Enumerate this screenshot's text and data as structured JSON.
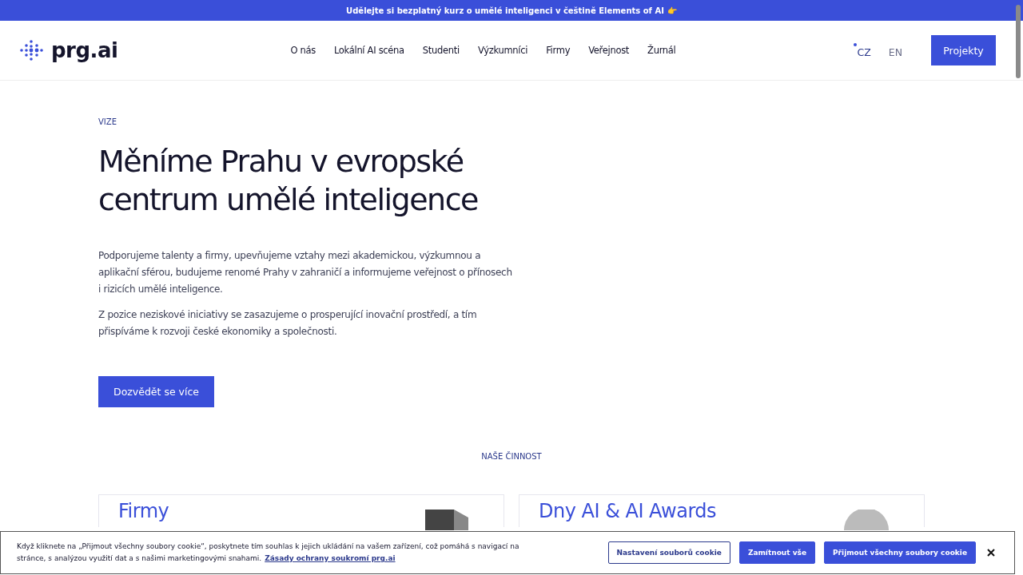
{
  "announcement": {
    "text": "Udělejte si bezplatný kurz o umělé inteligenci v češtině Elements of AI",
    "emoji": "👉"
  },
  "header": {
    "logo": "prg.ai",
    "nav": [
      "O nás",
      "Lokální AI scéna",
      "Studenti",
      "Výzkumníci",
      "Firmy",
      "Veřejnost",
      "Žurnál"
    ],
    "languages": [
      {
        "label": "CZ",
        "selected": true
      },
      {
        "label": "EN",
        "selected": false
      }
    ],
    "cta": "Projekty"
  },
  "hero": {
    "eyebrow": "VIZE",
    "title": "Měníme Prahu v evropské centrum umělé inteligence",
    "paragraphs": [
      "Podporujeme talenty a firmy, upevňujeme vztahy mezi akademickou, výzkumnou a aplikační sférou, budujeme renomé Prahy v zahraničí a informujeme veřejnost o přínosech i rizicích umělé inteligence.",
      "Z pozice neziskové iniciativy se zasazujeme o prosperující inovační prostředí, a tím přispíváme k rozvoji české ekonomiky a společnosti."
    ],
    "button": "Dozvědět se více"
  },
  "activities": {
    "eyebrow": "NAŠE ČINNOST",
    "cards": [
      {
        "title": "Firmy",
        "kind": "rack"
      },
      {
        "title": "Dny AI & AI Awards",
        "kind": "circle"
      }
    ]
  },
  "cookie_banner": {
    "text": "Když kliknete na „Přijmout všechny soubory cookie“, poskytnete tím souhlas k jejich ukládání na vašem zařízení, což pomáhá s navigací na stránce, s analýzou využití dat a s našimi marketingovými snahami.",
    "link": "Zásady ochrany soukromí prg.ai",
    "buttons": [
      {
        "label": "Nastavení souborů cookie",
        "kind": "outline"
      },
      {
        "label": "Zamítnout vše",
        "kind": "solid"
      },
      {
        "label": "Přijmout všechny soubory cookie",
        "kind": "solid"
      }
    ]
  }
}
